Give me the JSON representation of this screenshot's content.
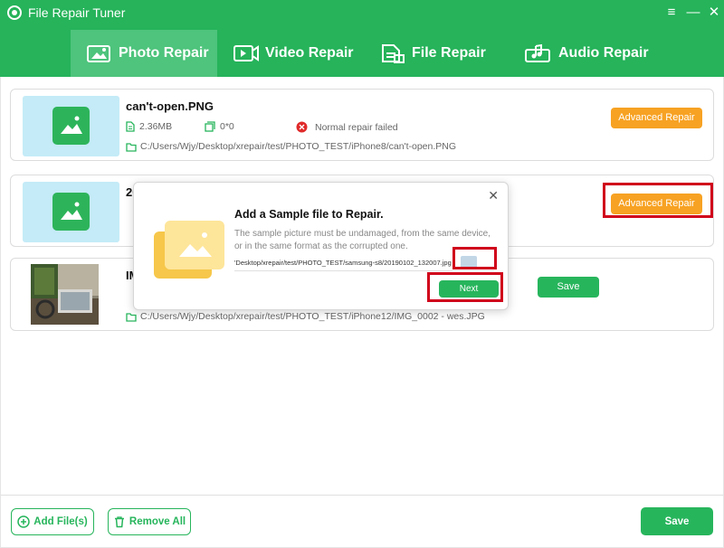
{
  "app": {
    "title": "File Repair Tuner"
  },
  "window": {
    "menu": "≡",
    "minimize": "—",
    "close": "✕"
  },
  "tabs": [
    {
      "label": "Photo Repair",
      "active": true
    },
    {
      "label": "Video Repair",
      "active": false
    },
    {
      "label": "File Repair",
      "active": false
    },
    {
      "label": "Audio Repair",
      "active": false
    }
  ],
  "files": [
    {
      "name": "can't-open.PNG",
      "size": "2.36MB",
      "resolution": "0*0",
      "status": "Normal repair failed",
      "path": "C:/Users/Wjy/Desktop/xrepair/test/PHOTO_TEST/iPhone8/can't-open.PNG",
      "action": "Advanced Repair"
    },
    {
      "name": "20",
      "action": "Advanced Repair"
    },
    {
      "name": "IMG",
      "path": "C:/Users/Wjy/Desktop/xrepair/test/PHOTO_TEST/iPhone12/IMG_0002 - wes.JPG",
      "save": "Save"
    }
  ],
  "dialog": {
    "title": "Add a Sample file to Repair.",
    "description": "The sample picture must be undamaged, from the same device, or in the same format as the corrupted one.",
    "path": "'Desktop/xrepair/test/PHOTO_TEST/samsung-s8/20190102_132007.jpg",
    "next": "Next",
    "close": "✕"
  },
  "footer": {
    "add_files": "Add File(s)",
    "remove_all": "Remove All",
    "save": "Save"
  },
  "colors": {
    "brand_green": "#26b35a",
    "active_tab": "#4ec47c",
    "orange": "#f7a223",
    "error_red": "#e02a2a",
    "highlight": "#d0021b"
  }
}
